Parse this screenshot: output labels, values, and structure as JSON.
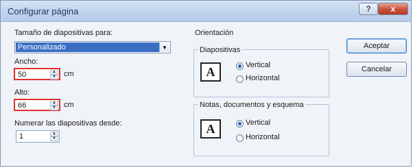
{
  "window": {
    "title": "Configurar página",
    "help_label": "?",
    "close_label": "x"
  },
  "slide_size": {
    "label": "Tamaño de diapositivas para:",
    "selected": "Personalizado",
    "dropdown_arrow": "▼"
  },
  "width": {
    "label": "Ancho:",
    "value": "50",
    "unit": "cm"
  },
  "height": {
    "label": "Alto:",
    "value": "66",
    "unit": "cm"
  },
  "numbering": {
    "label": "Numerar las diapositivas desde:",
    "value": "1"
  },
  "orientation": {
    "title": "Orientación",
    "slides": {
      "title": "Diapositivas",
      "icon_letter": "A",
      "options": [
        "Vertical",
        "Horizontal"
      ],
      "selected": "Vertical"
    },
    "notes": {
      "title": "Notas, documentos y esquema",
      "icon_letter": "A",
      "options": [
        "Vertical",
        "Horizontal"
      ],
      "selected": "Vertical"
    }
  },
  "buttons": {
    "ok": "Aceptar",
    "cancel": "Cancelar"
  },
  "colors": {
    "highlight": "#e03030",
    "selection": "#3a6fc4"
  }
}
